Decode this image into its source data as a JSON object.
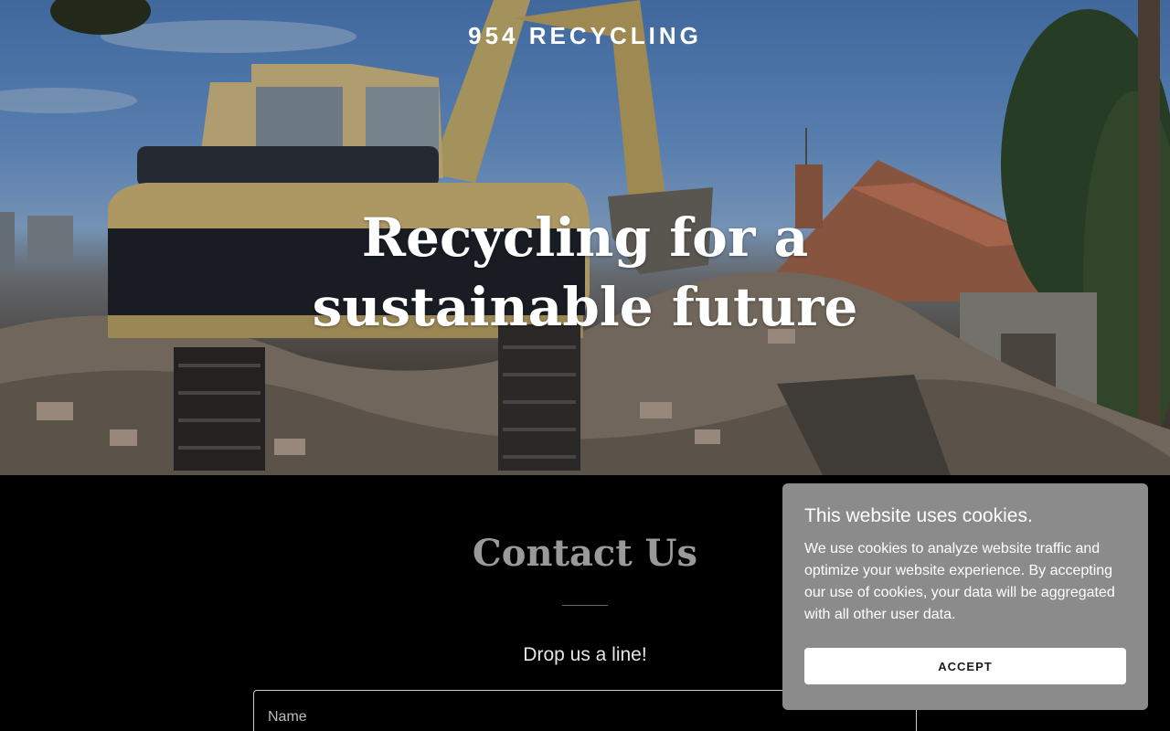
{
  "header": {
    "brand": "954 RECYCLING"
  },
  "hero": {
    "title": "Recycling for a sustainable future"
  },
  "contact": {
    "title": "Contact Us",
    "subtitle": "Drop us a line!",
    "name_placeholder": "Name"
  },
  "cookie_banner": {
    "title": "This website uses cookies.",
    "text": "We use cookies to analyze website traffic and optimize your website experience. By accepting our use of cookies, your data will be aggregated with all other user data.",
    "accept_label": "ACCEPT"
  },
  "colors": {
    "page_background": "#000000",
    "cookie_background": "#8b8b8b",
    "contact_title": "#9a9a9a"
  }
}
